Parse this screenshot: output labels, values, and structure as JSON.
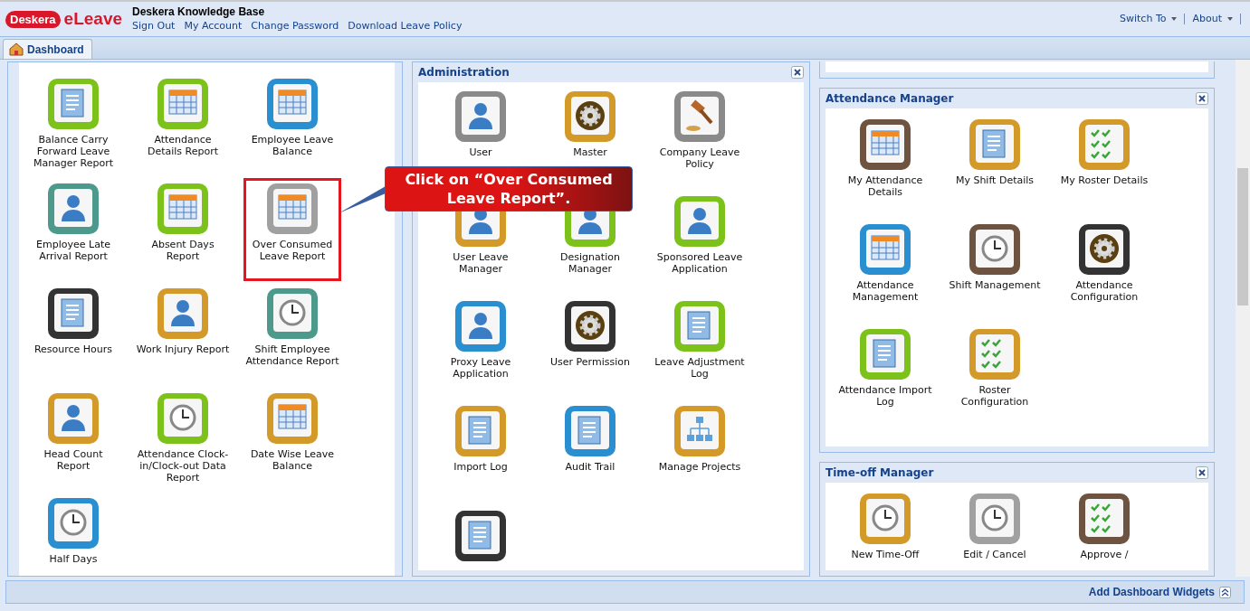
{
  "header": {
    "logo_badge": "Deskera",
    "logo_product": "eLeave",
    "title": "Deskera Knowledge Base",
    "links": [
      "Sign Out",
      "My Account",
      "Change Password",
      "Download Leave Policy"
    ],
    "menus": [
      "Switch To",
      "About"
    ]
  },
  "tabs": [
    {
      "label": "Dashboard",
      "selected": true
    }
  ],
  "columns": [
    {
      "panels": [
        {
          "tiles": [
            {
              "label": "Balance Carry Forward Leave Manager Report",
              "color": "#7cc21a",
              "kind": "doc",
              "highlighted": false
            },
            {
              "label": "Attendance Details Report",
              "color": "#7cc21a",
              "kind": "calendar",
              "highlighted": false
            },
            {
              "label": "Employee Leave Balance",
              "color": "#2a8fd0",
              "kind": "calendar",
              "highlighted": false
            },
            {
              "label": "Employee Late Arrival Report",
              "color": "#4d9a8c",
              "kind": "person",
              "highlighted": false
            },
            {
              "label": "Absent Days Report",
              "color": "#7cc21a",
              "kind": "calendar",
              "highlighted": false
            },
            {
              "label": "Over Consumed Leave Report",
              "color": "#a0a0a0",
              "kind": "calendar",
              "highlighted": true
            },
            {
              "label": "Resource Hours",
              "color": "#333333",
              "kind": "doc",
              "highlighted": false
            },
            {
              "label": "Work Injury Report",
              "color": "#d39a2a",
              "kind": "person",
              "highlighted": false
            },
            {
              "label": "Shift Employee Attendance Report",
              "color": "#4d9a8c",
              "kind": "clock",
              "highlighted": false
            },
            {
              "label": "Head Count Report",
              "color": "#d39a2a",
              "kind": "person",
              "highlighted": false
            },
            {
              "label": "Attendance Clock-in/Clock-out Data Report",
              "color": "#7cc21a",
              "kind": "clock",
              "highlighted": false
            },
            {
              "label": "Date Wise Leave Balance",
              "color": "#d39a2a",
              "kind": "calendar",
              "highlighted": false
            },
            {
              "label": "Half Days",
              "color": "#2a8fd0",
              "kind": "clock",
              "highlighted": false
            }
          ]
        }
      ]
    },
    {
      "panels": [
        {
          "title": "Administration",
          "closable": true,
          "tiles": [
            {
              "label": "User",
              "color": "#8a8a8a",
              "kind": "person",
              "highlighted": false
            },
            {
              "label": "Master",
              "color": "#d39a2a",
              "kind": "gear",
              "highlighted": false
            },
            {
              "label": "Company Leave Policy",
              "color": "#8a8a8a",
              "kind": "gavel",
              "highlighted": false
            },
            {
              "label": "User Leave Manager",
              "color": "#d39a2a",
              "kind": "person",
              "highlighted": false
            },
            {
              "label": "Designation Manager",
              "color": "#7cc21a",
              "kind": "person",
              "highlighted": false
            },
            {
              "label": "Sponsored Leave Application",
              "color": "#7cc21a",
              "kind": "person",
              "highlighted": false
            },
            {
              "label": "Proxy Leave Application",
              "color": "#2a8fd0",
              "kind": "person",
              "highlighted": false
            },
            {
              "label": "User Permission",
              "color": "#333333",
              "kind": "gear",
              "highlighted": false
            },
            {
              "label": "Leave Adjustment Log",
              "color": "#7cc21a",
              "kind": "doc",
              "highlighted": false
            },
            {
              "label": "Import Log",
              "color": "#d39a2a",
              "kind": "doc",
              "highlighted": false
            },
            {
              "label": "Audit Trail",
              "color": "#2a8fd0",
              "kind": "doc",
              "highlighted": false
            },
            {
              "label": "Manage Projects",
              "color": "#d39a2a",
              "kind": "org",
              "highlighted": false
            },
            {
              "color": "#333333",
              "kind": "doc",
              "highlighted": false
            }
          ]
        }
      ]
    },
    {
      "panels": [
        {
          "title": "Attendance Manager",
          "closable": true,
          "tiles": [
            {
              "label": "My Attendance Details",
              "color": "#6d5340",
              "kind": "calendar",
              "highlighted": false
            },
            {
              "label": "My Shift Details",
              "color": "#d39a2a",
              "kind": "doc",
              "highlighted": false
            },
            {
              "label": "My Roster Details",
              "color": "#d39a2a",
              "kind": "check",
              "highlighted": false
            },
            {
              "label": "Attendance Management",
              "color": "#2a8fd0",
              "kind": "calendar",
              "highlighted": false
            },
            {
              "label": "Shift Management",
              "color": "#6d5340",
              "kind": "clock",
              "highlighted": false
            },
            {
              "label": "Attendance Configuration",
              "color": "#333333",
              "kind": "gear",
              "highlighted": false
            },
            {
              "label": "Attendance Import Log",
              "color": "#7cc21a",
              "kind": "doc",
              "highlighted": false
            },
            {
              "label": "Roster Configuration",
              "color": "#d39a2a",
              "kind": "check",
              "highlighted": false
            }
          ]
        },
        {
          "title": "Time-off Manager",
          "closable": true,
          "tiles": [
            {
              "label": "New Time-Off",
              "color": "#d39a2a",
              "kind": "clock",
              "highlighted": false
            },
            {
              "label": "Edit / Cancel",
              "color": "#a0a0a0",
              "kind": "clock",
              "highlighted": false
            },
            {
              "label": "Approve /",
              "color": "#6d5340",
              "kind": "check",
              "highlighted": false
            }
          ]
        }
      ]
    }
  ],
  "callout": {
    "text": "Click on “Over Consumed Leave Report”."
  },
  "footer": {
    "action": "Add Dashboard Widgets"
  }
}
